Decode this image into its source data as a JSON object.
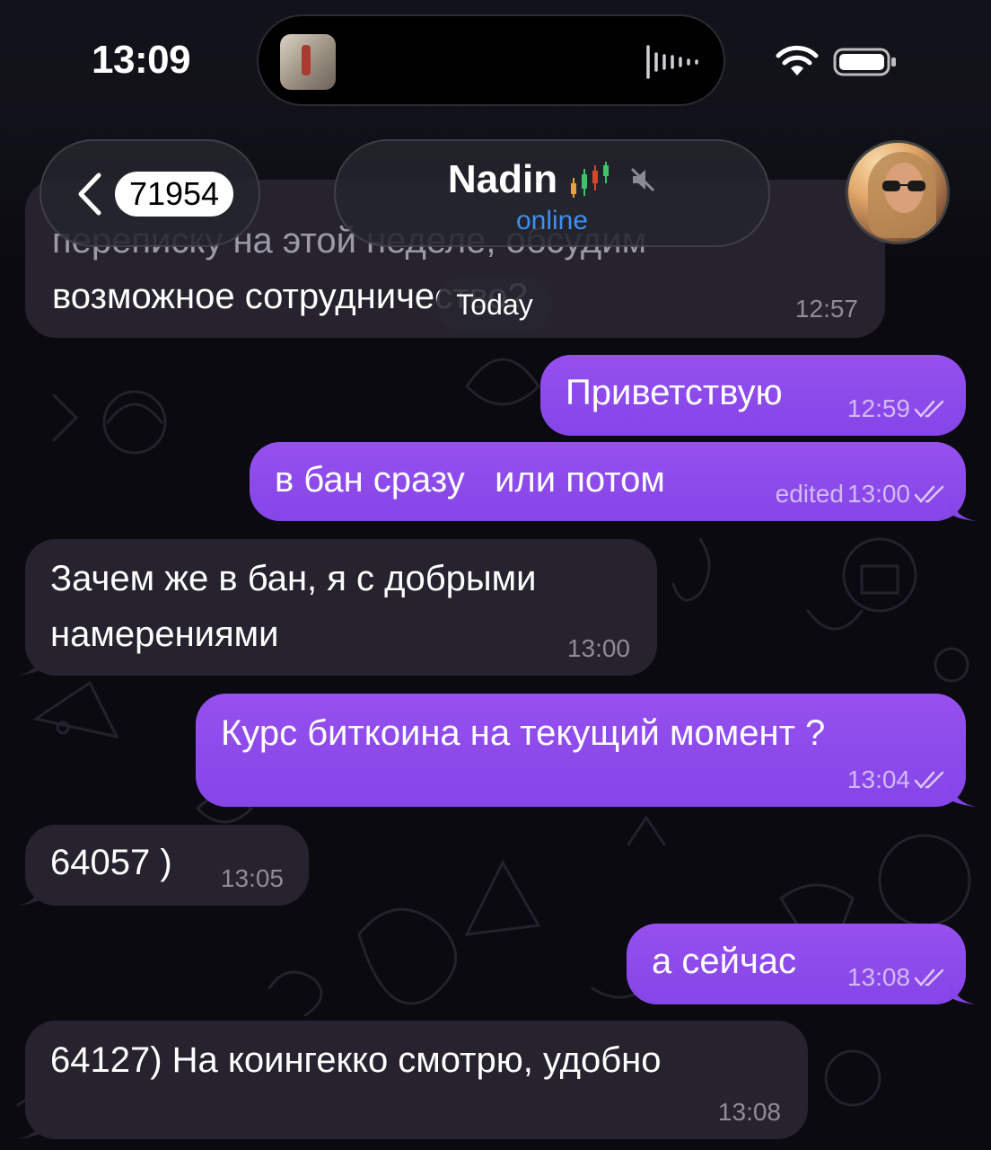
{
  "status_bar": {
    "time": "13:09"
  },
  "header": {
    "back_count": "71954",
    "contact_name": "Nadin",
    "status": "online"
  },
  "date_chip": "Today",
  "messages": [
    {
      "dir": "in",
      "lines": [
        "переписку на этой неделе, обсудим",
        "возможное сотрудничество?"
      ],
      "time": "12:57"
    },
    {
      "dir": "out",
      "text": "Приветствую",
      "time": "12:59"
    },
    {
      "dir": "out",
      "text": "в бан сразу   или потом",
      "edited": "edited",
      "time": "13:00"
    },
    {
      "dir": "in",
      "lines": [
        "Зачем же в бан, я с добрыми",
        "намерениями"
      ],
      "time": "13:00"
    },
    {
      "dir": "out",
      "text": "Курс биткоина на текущий момент ?",
      "time": "13:04"
    },
    {
      "dir": "in",
      "text": "64057 )",
      "time": "13:05"
    },
    {
      "dir": "out",
      "text": "а сейчас",
      "time": "13:08"
    },
    {
      "dir": "in",
      "text": "64127) На коингекко смотрю, удобно",
      "time": "13:08"
    }
  ],
  "colors": {
    "outgoing": "#8f4bec",
    "incoming": "#26232f",
    "accent_status": "#3f8ef0",
    "background": "#0b0a10"
  },
  "icons": [
    "back-chevron-icon",
    "candlestick-chart-icon",
    "mute-icon",
    "double-check-icon",
    "wifi-icon",
    "battery-icon",
    "audio-wave-icon"
  ]
}
